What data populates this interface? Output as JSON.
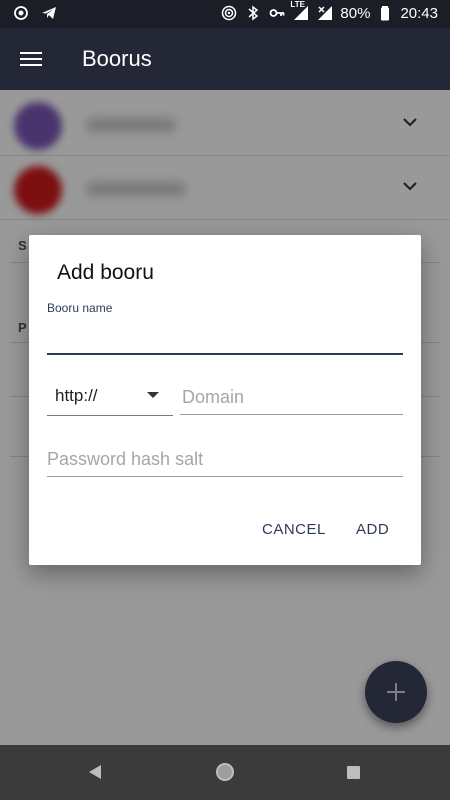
{
  "status_bar": {
    "battery": "80%",
    "time": "20:43",
    "network_label": "LTE",
    "icons": [
      "record-icon",
      "telegram-icon",
      "hotspot-icon",
      "bluetooth-icon",
      "vpn-key-icon",
      "signal-lte-icon",
      "signal-no-sim-icon",
      "battery-icon"
    ]
  },
  "app_bar": {
    "title": "Boorus",
    "menu_icon": "hamburger-menu-icon"
  },
  "background": {
    "rows": [
      {
        "avatar_color": "#7b57b8",
        "chevron": "chevron-down-icon"
      },
      {
        "avatar_color": "#d0191d",
        "chevron": "chevron-down-icon"
      }
    ],
    "section_labels": [
      "S",
      "P"
    ]
  },
  "dialog": {
    "title": "Add booru",
    "name_label": "Booru name",
    "name_value": "",
    "protocol_value": "http://",
    "domain_placeholder": "Domain",
    "salt_placeholder": "Password hash salt",
    "cancel_label": "CANCEL",
    "add_label": "ADD"
  },
  "fab": {
    "icon": "plus-icon"
  },
  "colors": {
    "status_bar": "#1b1e27",
    "app_bar": "#242836",
    "accent": "#2f3a5a",
    "fab": "#242836",
    "nav_bar": "#3b3b3b"
  }
}
